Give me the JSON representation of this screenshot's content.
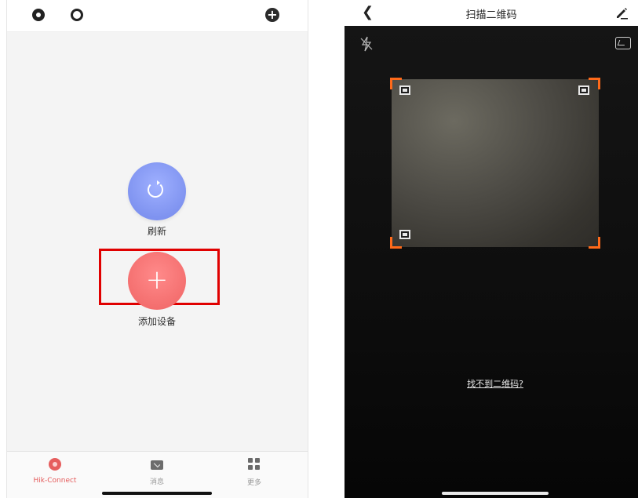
{
  "left_screen": {
    "header": {
      "icons": [
        "camera-icon",
        "ring-icon",
        "add-circle-icon"
      ]
    },
    "refresh": {
      "label": "刷新",
      "icon": "refresh-icon",
      "color": "#7f93f0"
    },
    "add_device": {
      "label": "添加设备",
      "icon": "plus-icon",
      "color": "#f46f6f",
      "highlight_color": "#e00000"
    },
    "tabs": [
      {
        "label": "Hik-Connect",
        "icon": "hik-connect-icon",
        "active": true
      },
      {
        "label": "消息",
        "icon": "mail-icon",
        "active": false
      },
      {
        "label": "更多",
        "icon": "grid-icon",
        "active": false
      }
    ]
  },
  "right_screen": {
    "header": {
      "title": "扫描二维码",
      "back_icon": "back-chevron-icon",
      "edit_icon": "pencil-icon"
    },
    "flash_icon": "flash-off-icon",
    "gallery_icon": "image-icon",
    "corner_color": "#ff6a1a",
    "help_link": "找不到二维码?"
  }
}
